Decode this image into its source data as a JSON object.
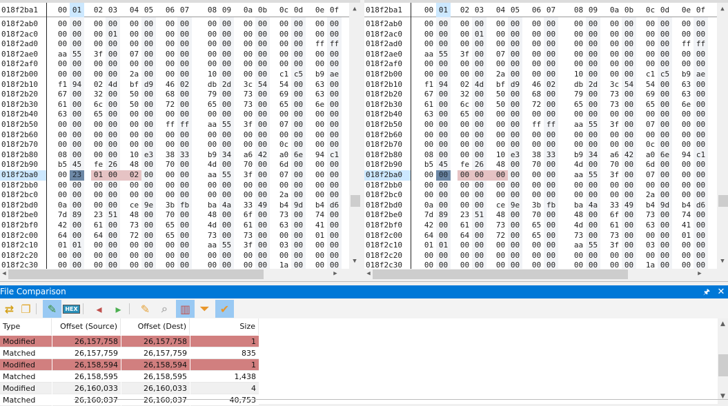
{
  "hex_header": {
    "cursor_offset": "018f2ba1",
    "columns": [
      "00",
      "01",
      "02",
      "03",
      "04",
      "05",
      "06",
      "07",
      "08",
      "09",
      "0a",
      "0b",
      "0c",
      "0d",
      "0e",
      "0f"
    ],
    "highlighted_column": "01"
  },
  "offsets": [
    "018f2ab0",
    "018f2ac0",
    "018f2ad0",
    "018f2ae0",
    "018f2af0",
    "018f2b00",
    "018f2b10",
    "018f2b20",
    "018f2b30",
    "018f2b40",
    "018f2b50",
    "018f2b60",
    "018f2b70",
    "018f2b80",
    "018f2b90",
    "018f2ba0",
    "018f2bb0",
    "018f2bc0",
    "018f2bd0",
    "018f2be0",
    "018f2bf0",
    "018f2c00",
    "018f2c10",
    "018f2c20",
    "018f2c30"
  ],
  "current_row": "018f2ba0",
  "source_rows": [
    "00 00 00 00 00 00 00 00 00 00 00 00 00 00 00 00",
    "00 00 00 01 00 00 00 00 00 00 00 00 00 00 00 00",
    "00 00 00 00 00 00 00 00 00 00 00 00 00 00 ff ff",
    "aa 55 3f 00 07 00 00 00 00 00 00 00 00 00 00 00",
    "00 00 00 00 00 00 00 00 00 00 00 00 00 00 00 00",
    "00 00 00 00 2a 00 00 00 10 00 00 00 c1 c5 b9 ae",
    "f1 94 02 4d bf d9 46 02 db 2d 3c 54 54 00 63 00",
    "67 00 32 00 50 00 68 00 79 00 73 00 69 00 63 00",
    "61 00 6c 00 50 00 72 00 65 00 73 00 65 00 6e 00",
    "63 00 65 00 00 00 00 00 00 00 00 00 00 00 00 00",
    "00 00 00 00 00 00 ff ff aa 55 3f 00 07 00 00 00",
    "00 00 00 00 00 00 00 00 00 00 00 00 00 00 00 00",
    "00 00 00 00 00 00 00 00 00 00 00 00 0c 00 00 00",
    "08 00 00 00 10 e3 38 33 b9 34 a6 42 a0 6e 94 c1",
    "b5 45 fe 26 48 00 70 00 4d 00 70 00 6d 00 00 00",
    "00 23 01 00 02 00 00 00 aa 55 3f 00 07 00 00 00",
    "00 00 00 00 00 00 00 00 00 00 00 00 00 00 00 00",
    "00 00 00 00 00 00 00 00 00 00 00 00 2a 00 00 00",
    "0a 00 00 00 ce 9e 3b fb ba 4a 33 49 b4 9d b4 d6",
    "7d 89 23 51 48 00 70 00 48 00 6f 00 73 00 74 00",
    "42 00 61 00 73 00 65 00 4d 00 61 00 63 00 41 00",
    "64 00 64 00 72 00 65 00 73 00 73 00 00 00 01 00",
    "01 01 00 00 00 00 00 00 aa 55 3f 00 03 00 00 00",
    "00 00 00 00 00 00 00 00 00 00 00 00 00 00 00 00",
    "00 00 00 00 00 00 00 00 00 00 00 00 1a 00 00 00"
  ],
  "dest_rows": [
    "00 00 00 00 00 00 00 00 00 00 00 00 00 00 00 00",
    "00 00 00 01 00 00 00 00 00 00 00 00 00 00 00 00",
    "00 00 00 00 00 00 00 00 00 00 00 00 00 00 ff ff",
    "aa 55 3f 00 07 00 00 00 00 00 00 00 00 00 00 00",
    "00 00 00 00 00 00 00 00 00 00 00 00 00 00 00 00",
    "00 00 00 00 2a 00 00 00 10 00 00 00 c1 c5 b9 ae",
    "f1 94 02 4d bf d9 46 02 db 2d 3c 54 54 00 63 00",
    "67 00 32 00 50 00 68 00 79 00 73 00 69 00 63 00",
    "61 00 6c 00 50 00 72 00 65 00 73 00 65 00 6e 00",
    "63 00 65 00 00 00 00 00 00 00 00 00 00 00 00 00",
    "00 00 00 00 00 00 ff ff aa 55 3f 00 07 00 00 00",
    "00 00 00 00 00 00 00 00 00 00 00 00 00 00 00 00",
    "00 00 00 00 00 00 00 00 00 00 00 00 0c 00 00 00",
    "08 00 00 00 10 e3 38 33 b9 34 a6 42 a0 6e 94 c1",
    "b5 45 fe 26 48 00 70 00 4d 00 70 00 6d 00 00 00",
    "00 00 00 00 00 00 00 00 aa 55 3f 00 07 00 00 00",
    "00 00 00 00 00 00 00 00 00 00 00 00 00 00 00 00",
    "00 00 00 00 00 00 00 00 00 00 00 00 2a 00 00 00",
    "0a 00 00 00 ce 9e 3b fb ba 4a 33 49 b4 9d b4 d6",
    "7d 89 23 51 48 00 70 00 48 00 6f 00 73 00 74 00",
    "42 00 61 00 73 00 65 00 4d 00 61 00 63 00 41 00",
    "64 00 64 00 72 00 65 00 73 00 73 00 00 00 01 00",
    "01 01 00 00 00 00 00 00 aa 55 3f 00 03 00 00 00",
    "00 00 00 00 00 00 00 00 00 00 00 00 00 00 00 00",
    "00 00 00 00 00 00 00 00 00 00 00 00 1a 00 00 00"
  ],
  "selected_byte_column": 1,
  "diff_byte_columns": [
    2,
    3,
    4
  ],
  "comparison": {
    "title": "File Comparison",
    "toolbar": [
      "compare-icon",
      "copy-icon",
      "highlight-icon",
      "hex-icon",
      "prev-diff-icon",
      "next-diff-icon",
      "clear-icon",
      "find-icon",
      "split-view-icon",
      "filter-icon",
      "filter-check-icon"
    ],
    "columns": [
      "Type",
      "Offset (Source)",
      "Offset (Dest)",
      "Size"
    ],
    "rows": [
      {
        "type": "Modified",
        "src": "26,157,758",
        "dst": "26,157,758",
        "size": "1"
      },
      {
        "type": "Matched",
        "src": "26,157,759",
        "dst": "26,157,759",
        "size": "835"
      },
      {
        "type": "Modified",
        "src": "26,158,594",
        "dst": "26,158,594",
        "size": "1"
      },
      {
        "type": "Matched",
        "src": "26,158,595",
        "dst": "26,158,595",
        "size": "1,438"
      },
      {
        "type": "Modified",
        "src": "26,160,033",
        "dst": "26,160,033",
        "size": "4"
      },
      {
        "type": "Matched",
        "src": "26,160,037",
        "dst": "26,160,037",
        "size": "40,753"
      }
    ]
  },
  "colors": {
    "modified": "#d17f7f",
    "accent": "#0078d7",
    "selected_byte": "#6d88a6",
    "diff_byte": "#e6c3c4",
    "current_row": "#cce8ff"
  }
}
